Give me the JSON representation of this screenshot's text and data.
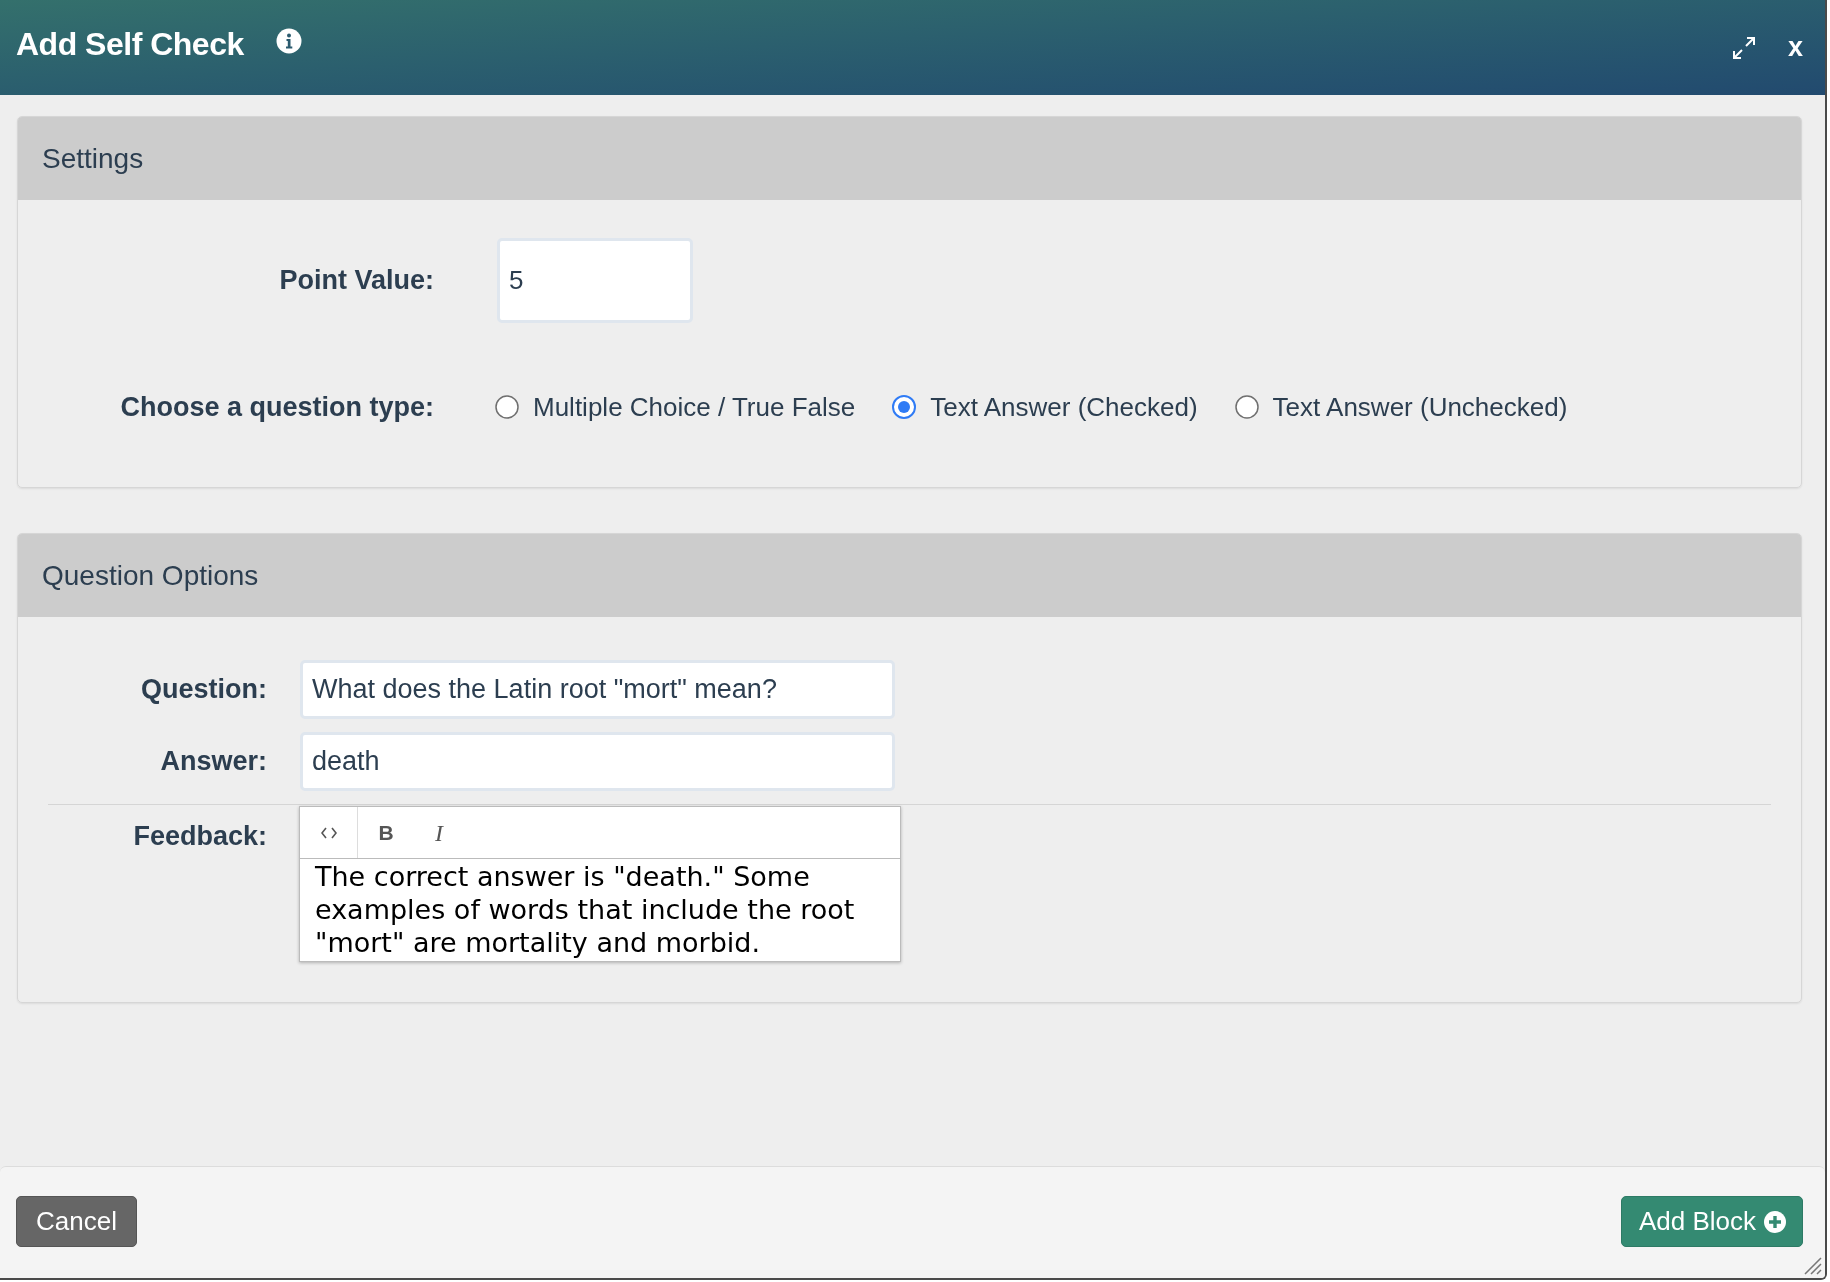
{
  "dialog": {
    "title": "Add Self Check",
    "close": "x"
  },
  "settings": {
    "title": "Settings",
    "point_value": {
      "label": "Point Value:",
      "value": "5"
    },
    "question_type": {
      "label": "Choose a question type:",
      "options": [
        {
          "label": "Multiple Choice / True False",
          "selected": false
        },
        {
          "label": "Text Answer (Checked)",
          "selected": true
        },
        {
          "label": "Text Answer (Unchecked)",
          "selected": false
        }
      ]
    }
  },
  "question_options": {
    "title": "Question Options",
    "fields": [
      {
        "label": "Question:",
        "value": "What does the Latin root \"mort\" mean?"
      },
      {
        "label": "Answer:",
        "value": "death"
      }
    ],
    "feedback": {
      "label": "Feedback:",
      "toolbar": [
        {
          "kind": "source"
        },
        {
          "kind": "bold",
          "label": "B"
        },
        {
          "kind": "italic",
          "label": "I"
        }
      ],
      "text": "The correct answer is \"death.\" Some examples of words that include the root \"mort\" are mortality and morbid."
    }
  },
  "footer": {
    "buttons": [
      {
        "label": "Cancel",
        "kind": "secondary"
      },
      {
        "label": "Add Block",
        "kind": "primary"
      }
    ]
  }
}
